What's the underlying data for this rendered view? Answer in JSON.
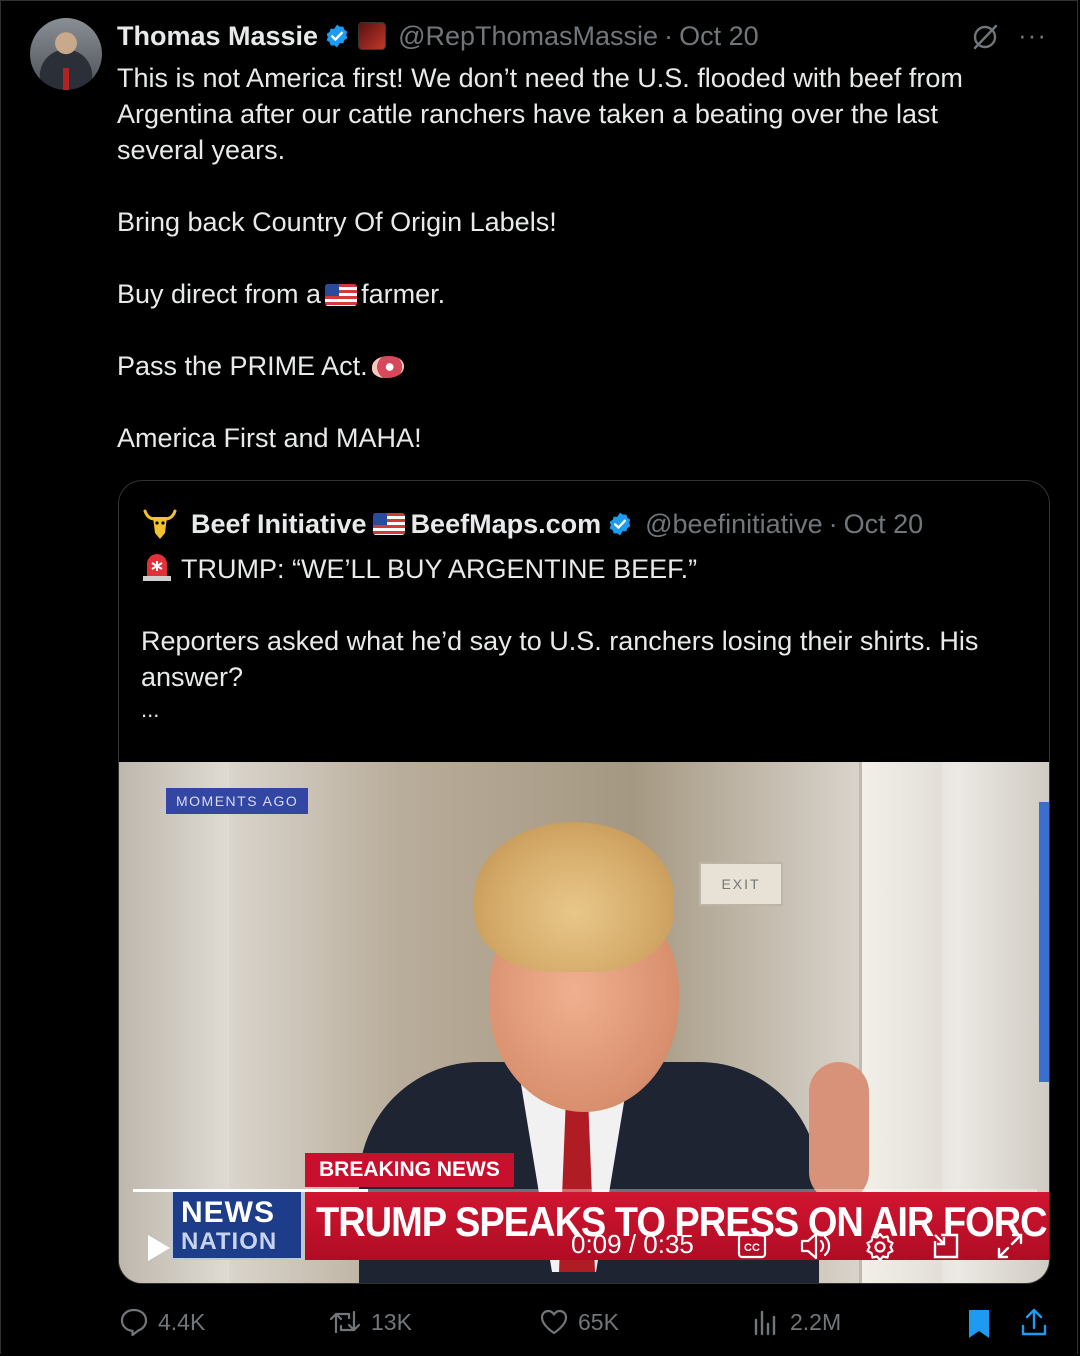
{
  "post": {
    "author_name": "Thomas Massie",
    "handle": "@RepThomasMassie",
    "separator": "·",
    "date": "Oct 20",
    "lines": [
      "This is not America first! We don’t need the U.S. flooded with beef from Argentina after our cattle ranchers have taken a beating over the last several years.",
      "Bring back Country Of Origin Labels!",
      "Buy direct from a",
      "farmer.",
      "Pass the PRIME Act.",
      "America First and MAHA!"
    ]
  },
  "quote": {
    "author_name": "Beef Initiative",
    "author_site": "BeefMaps.com",
    "handle": "@beefinitiative",
    "separator": "·",
    "date": "Oct 20",
    "headline": "TRUMP: “WE’LL BUY ARGENTINE BEEF.”",
    "body": "Reporters asked what he’d say to U.S. ranchers losing their shirts. His answer?",
    "ellipsis": "..."
  },
  "video": {
    "tag": "MOMENTS AGO",
    "breaking": "BREAKING NEWS",
    "banner": "TRUMP SPEAKS TO PRESS ON AIR FORCE ONE",
    "exit_sign": "EXIT",
    "logo_line1": "NEWS",
    "logo_line2": "NATION",
    "time": "0:09 / 0:35",
    "progress": 0.26,
    "cc_label": "CC"
  },
  "actions": {
    "replies": "4.4K",
    "reposts": "13K",
    "likes": "65K",
    "views": "2.2M"
  },
  "colors": {
    "background": "#000000",
    "text": "#e7e9ea",
    "muted": "#71767b",
    "verified": "#1d9bf0",
    "bookmark": "#1d9bf0",
    "breaking_red": "#c8102e"
  }
}
